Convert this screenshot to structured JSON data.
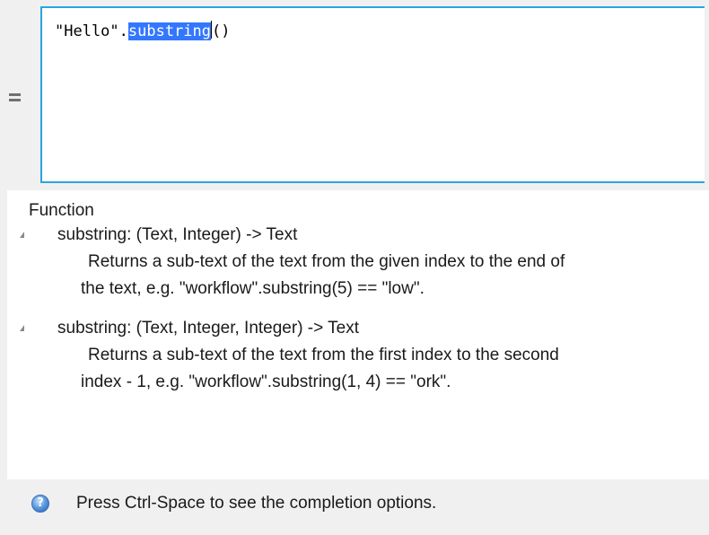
{
  "editor": {
    "code_prefix": "\"Hello\".",
    "code_selected": "substring",
    "code_suffix": "()"
  },
  "info": {
    "heading": "Function",
    "entries": [
      {
        "signature": "substring: (Text, Integer) -> Text",
        "desc_line1": "Returns a sub-text of the text from the given index to the end of",
        "desc_line2": "the text, e.g. \"workflow\".substring(5) == \"low\"."
      },
      {
        "signature": "substring: (Text, Integer, Integer) -> Text",
        "desc_line1": "Returns a sub-text of the text from the first index to the second",
        "desc_line2": "index - 1, e.g. \"workflow\".substring(1, 4) == \"ork\"."
      }
    ]
  },
  "status": {
    "help_icon_glyph": "?",
    "text": "Press Ctrl-Space to see the completion options."
  },
  "colors": {
    "editor_border": "#2aa5e0",
    "selection": "#3377ff"
  },
  "icons": {
    "equals": "equals-icon",
    "help": "help-icon",
    "collapse": "expanded-triangle-icon"
  }
}
